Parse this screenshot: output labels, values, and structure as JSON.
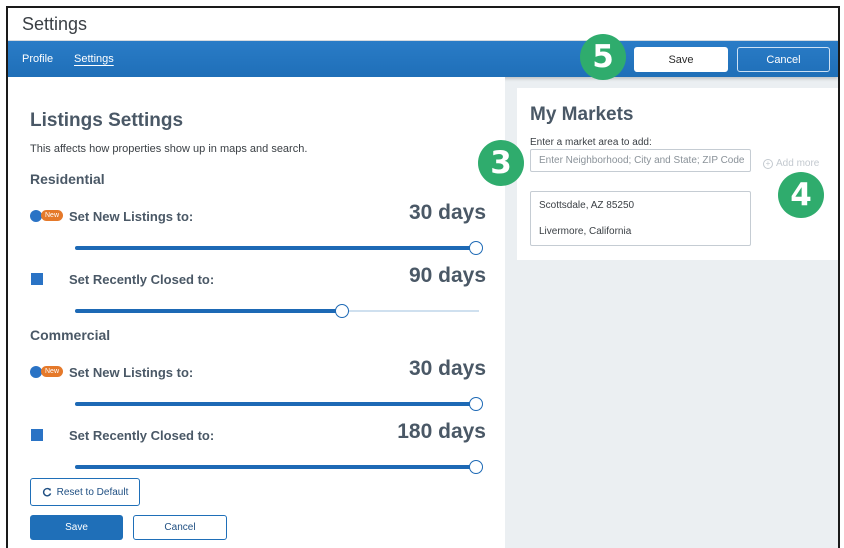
{
  "window": {
    "title": "Settings"
  },
  "nav": {
    "tabs": [
      {
        "label": "Profile"
      },
      {
        "label": "Settings"
      }
    ],
    "save_label": "Save",
    "cancel_label": "Cancel"
  },
  "listings": {
    "title": "Listings Settings",
    "description": "This affects how properties show up in maps and search.",
    "sections": [
      {
        "heading": "Residential",
        "settings": [
          {
            "label": "Set New Listings to:",
            "value": "30 days",
            "badge": "New",
            "slider_fraction": 1.0
          },
          {
            "label": "Set Recently Closed to:",
            "value": "90 days",
            "slider_fraction": 0.66
          }
        ]
      },
      {
        "heading": "Commercial",
        "settings": [
          {
            "label": "Set New Listings to:",
            "value": "30 days",
            "badge": "New",
            "slider_fraction": 1.0
          },
          {
            "label": "Set Recently Closed to:",
            "value": "180 days",
            "slider_fraction": 1.0
          }
        ]
      }
    ],
    "reset_label": "Reset to Default",
    "save_label": "Save",
    "cancel_label": "Cancel"
  },
  "markets": {
    "title": "My Markets",
    "field_label": "Enter a market area to add:",
    "input_placeholder": "Enter Neighborhood; City and State; ZIP Code",
    "add_more_label": "Add more",
    "items": [
      "Scottsdale, AZ 85250",
      "Livermore, California"
    ]
  },
  "callouts": [
    "3",
    "4",
    "5"
  ],
  "colors": {
    "primary": "#1f6fb8",
    "callout": "#2fac6d",
    "badge": "#e5792a"
  },
  "icons": {
    "reset": "refresh-icon",
    "add": "plus-circle-icon",
    "new_marker": "dot-icon",
    "closed_marker": "square-icon"
  }
}
